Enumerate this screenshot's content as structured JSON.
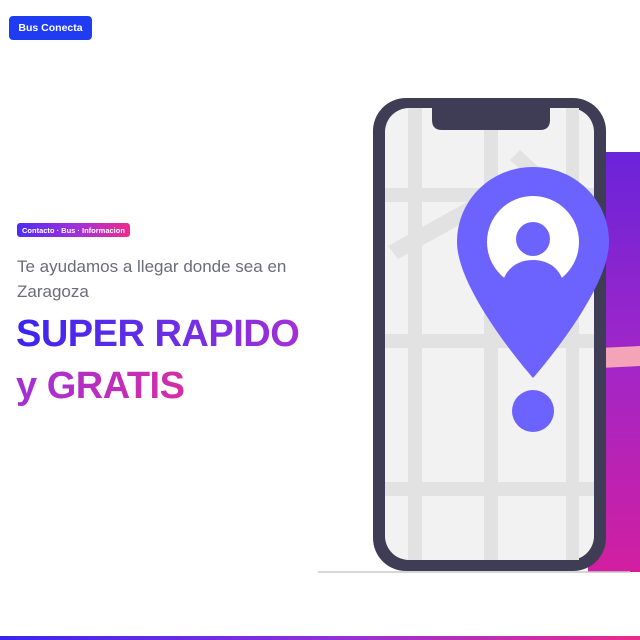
{
  "header": {
    "brand_label": "Bus Conecta"
  },
  "hero": {
    "tag": "Contacto · Bus · Informacion",
    "subtitle": "Te ayudamos a llegar donde sea en Zaragoza",
    "headline_line1": "SUPER RAPIDO",
    "headline_line2": "y GRATIS"
  },
  "colors": {
    "brand_blue": "#1f3cf2",
    "gradient_start": "#3a24ee",
    "gradient_end": "#ec2a8c",
    "pin_purple": "#6c63ff",
    "phone_frame": "#3f3d56",
    "map_bg": "#f2f2f2",
    "map_roads": "#e2e2e2"
  },
  "icons": {
    "pin": "location-pin-icon",
    "person": "person-icon"
  }
}
